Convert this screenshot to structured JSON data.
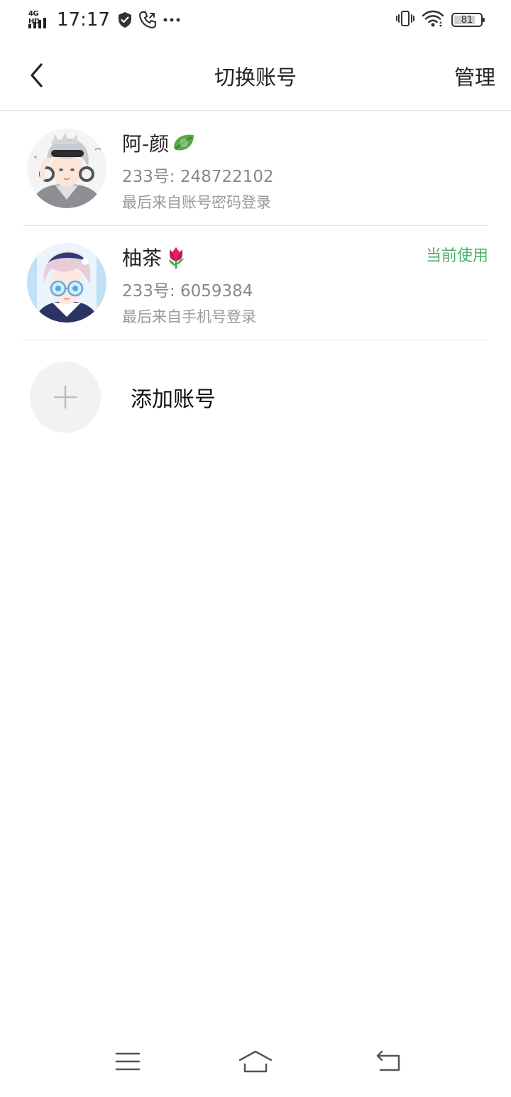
{
  "status_bar": {
    "network": "4G HD",
    "time": "17:17",
    "battery_level": "81",
    "battery_fraction": 0.81,
    "icons": [
      "signal-icon",
      "shield-icon",
      "call-icon",
      "more-dots-icon",
      "vibrate-icon",
      "wifi-icon",
      "battery-icon"
    ]
  },
  "header": {
    "title": "切换账号",
    "manage_label": "管理",
    "back_icon": "chevron-left-icon"
  },
  "accounts": [
    {
      "name": "阿-颜",
      "emoji": "leaf-emoji",
      "id_text": "233号: 248722102",
      "login_text": "最后来自账号密码登录",
      "current_label": ""
    },
    {
      "name": "柚茶",
      "emoji": "tulip-emoji",
      "id_text": "233号: 6059384",
      "login_text": "最后来自手机号登录",
      "current_label": "当前使用"
    }
  ],
  "add_account": {
    "label": "添加账号",
    "icon": "plus-icon"
  },
  "colors": {
    "accent_green": "#4caf69",
    "text_primary": "#222222",
    "text_secondary": "#888888",
    "divider": "#e8e8e8"
  },
  "bottom_nav": {
    "icons": [
      "menu-icon",
      "home-icon",
      "back-icon"
    ]
  }
}
